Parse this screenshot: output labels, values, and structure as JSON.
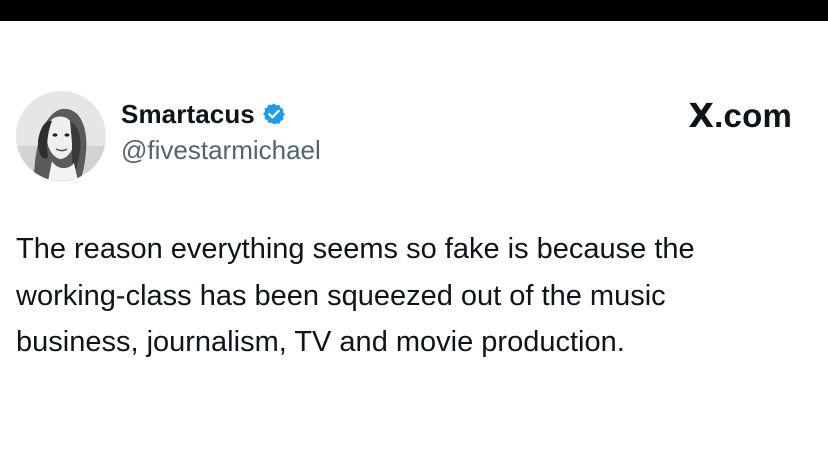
{
  "post": {
    "author": {
      "display_name": "Smartacus",
      "handle": "@fivestarmichael",
      "verified": true,
      "avatar_icon": "profile-photo-grayscale"
    },
    "brand": {
      "x_glyph": "X",
      "suffix": ".com"
    },
    "text_lines": [
      "The reason everything seems so fake is because the",
      "working-class has been squeezed out of the music",
      "business, journalism, TV and movie production."
    ]
  },
  "colors": {
    "top_bar": "#000000",
    "background": "#ffffff",
    "text": "#0f1419",
    "handle": "#536471",
    "verified_badge": "#1d9bf0"
  }
}
